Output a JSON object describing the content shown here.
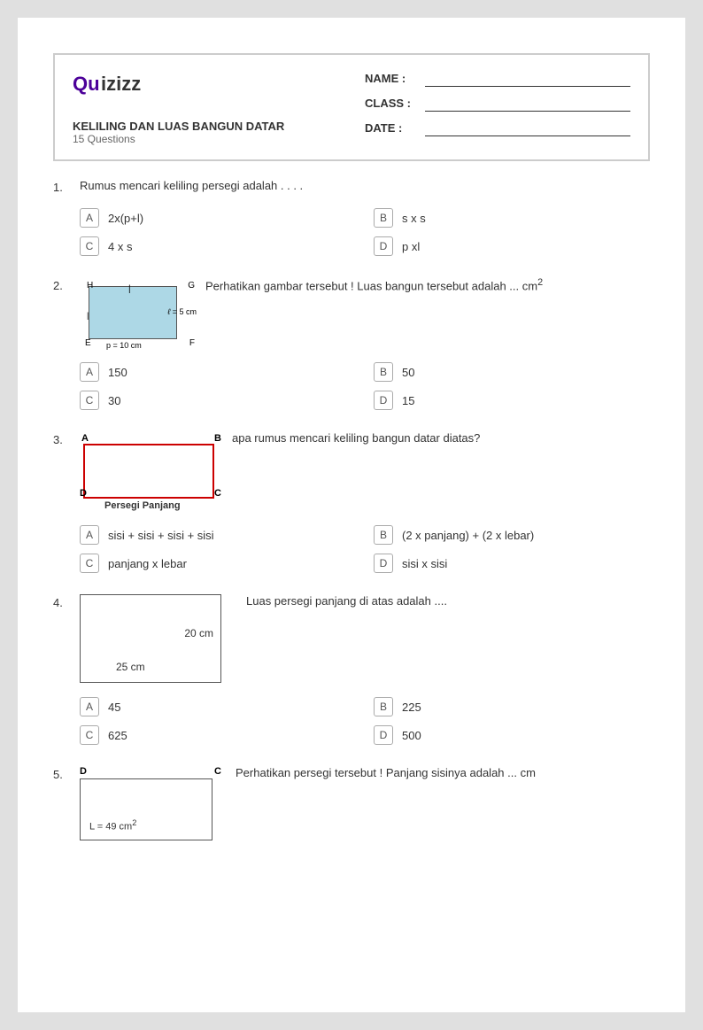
{
  "header": {
    "logo": "Quizizz",
    "title": "KELILING DAN LUAS BANGUN DATAR",
    "subtitle": "15 Questions",
    "name_label": "NAME :",
    "class_label": "CLASS :",
    "date_label": "DATE :"
  },
  "questions": [
    {
      "number": "1.",
      "text": "Rumus mencari keliling persegi adalah . . . .",
      "options": [
        {
          "letter": "A",
          "text": "2x(p+l)"
        },
        {
          "letter": "B",
          "text": "s x s"
        },
        {
          "letter": "C",
          "text": "4 x s"
        },
        {
          "letter": "D",
          "text": "p xl"
        }
      ]
    },
    {
      "number": "2.",
      "text": "Perhatikan gambar tersebut ! Luas bangun tersebut adalah ... cm²",
      "options": [
        {
          "letter": "A",
          "text": "150"
        },
        {
          "letter": "B",
          "text": "50"
        },
        {
          "letter": "C",
          "text": "30"
        },
        {
          "letter": "D",
          "text": "15"
        }
      ]
    },
    {
      "number": "3.",
      "text": "apa rumus mencari keliling bangun datar diatas?",
      "options": [
        {
          "letter": "A",
          "text": "sisi + sisi + sisi + sisi"
        },
        {
          "letter": "B",
          "text": "(2 x panjang) + (2 x lebar)"
        },
        {
          "letter": "C",
          "text": "panjang x lebar"
        },
        {
          "letter": "D",
          "text": "sisi x sisi"
        }
      ]
    },
    {
      "number": "4.",
      "text": "Luas persegi panjang di atas adalah ....",
      "dim_right": "20 cm",
      "dim_bottom": "25 cm",
      "options": [
        {
          "letter": "A",
          "text": "45"
        },
        {
          "letter": "B",
          "text": "225"
        },
        {
          "letter": "C",
          "text": "625"
        },
        {
          "letter": "D",
          "text": "500"
        }
      ]
    },
    {
      "number": "5.",
      "text": "Perhatikan persegi tersebut ! Panjang sisinya adalah ... cm",
      "inner_text": "L = 49 cm²",
      "options": []
    }
  ]
}
